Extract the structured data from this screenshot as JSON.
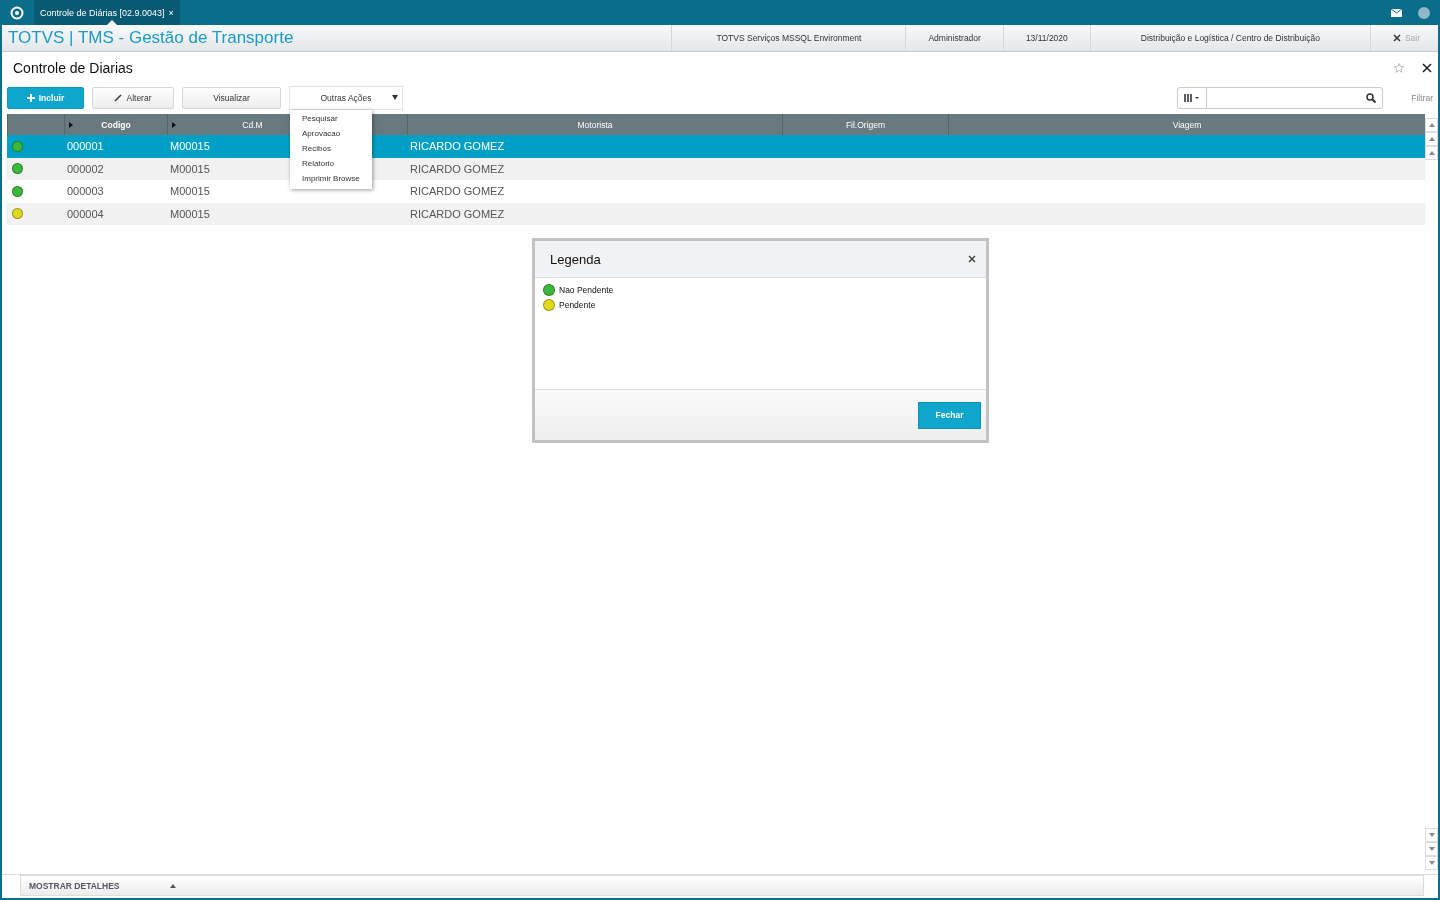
{
  "window_tab": {
    "title": "Controle de Diárias [02.9.0043]",
    "close": "×"
  },
  "header": {
    "app_title": "TOTVS | TMS - Gestão de Transporte",
    "environment": "TOTVS Serviços MSSQL Environment",
    "user": "Administrador",
    "date": "13/11/2020",
    "module": "Distribuição e Logística / Centro de Distribuição",
    "exit": "Sair"
  },
  "page_title": "Controle de Diarias",
  "toolbar": {
    "buttons": [
      {
        "label": "Incluir",
        "kind": "primary"
      },
      {
        "label": "Alterar",
        "kind": "edit"
      },
      {
        "label": "Visualizar",
        "kind": "plain"
      }
    ],
    "more_actions": "Outras Ações",
    "filter": "Filtrar"
  },
  "menu": [
    "Pesquisar",
    "Aprovacao",
    "Recibos",
    "Relatorio",
    "Imprimir Browse"
  ],
  "table": {
    "columns": [
      "Codigo",
      "Cd.M",
      "Motorista",
      "Fil.Origem",
      "Viagem"
    ],
    "rows": [
      {
        "color": "#3cb83c",
        "selected": true,
        "cells": [
          "000001",
          "M00015",
          "RICARDO GOMEZ",
          "",
          ""
        ]
      },
      {
        "color": "#3cb83c",
        "selected": false,
        "cells": [
          "000002",
          "M00015",
          "RICARDO GOMEZ",
          "",
          ""
        ]
      },
      {
        "color": "#3cb83c",
        "selected": false,
        "cells": [
          "000003",
          "M00015",
          "RICARDO GOMEZ",
          "",
          ""
        ]
      },
      {
        "color": "#e0d81c",
        "selected": false,
        "cells": [
          "000004",
          "M00015",
          "RICARDO GOMEZ",
          "",
          ""
        ]
      }
    ]
  },
  "legend_dialog": {
    "title": "Legenda",
    "items": [
      {
        "label": "Nao Pendente",
        "color": "#3cb83c"
      },
      {
        "label": "Pendente",
        "color": "#e0d81c"
      }
    ],
    "button": "Fechar"
  },
  "details_bar": "MOSTRAR DETALHES"
}
